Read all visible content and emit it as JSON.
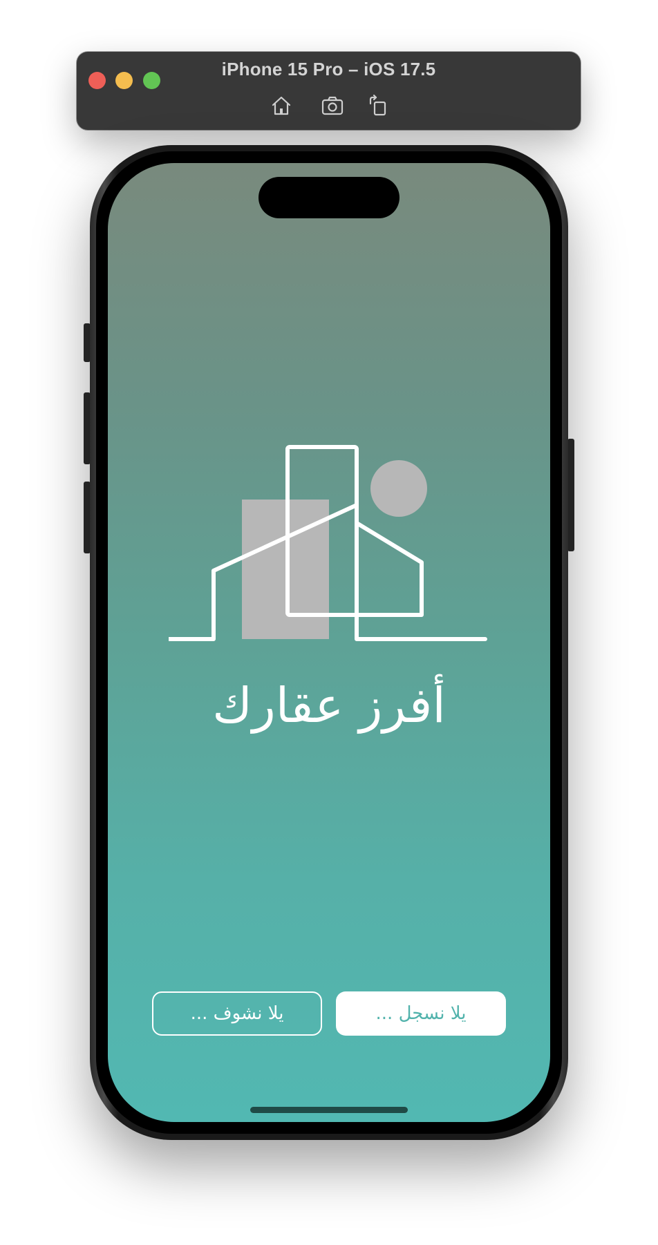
{
  "simulator": {
    "title": "iPhone 15 Pro – iOS 17.5",
    "toolbar_icons": [
      "home-icon",
      "screenshot-icon",
      "rotate-icon"
    ]
  },
  "app": {
    "title": "أفرز عقارك",
    "browse_button_label": "يلا نشوف ...",
    "register_button_label": "يلا نسجل ..."
  },
  "colors": {
    "gradient_top": "#798a7d",
    "gradient_bottom": "#52b8b2",
    "accent": "#52b3ac",
    "logo_gray": "#b7b7b7",
    "white": "#ffffff"
  }
}
